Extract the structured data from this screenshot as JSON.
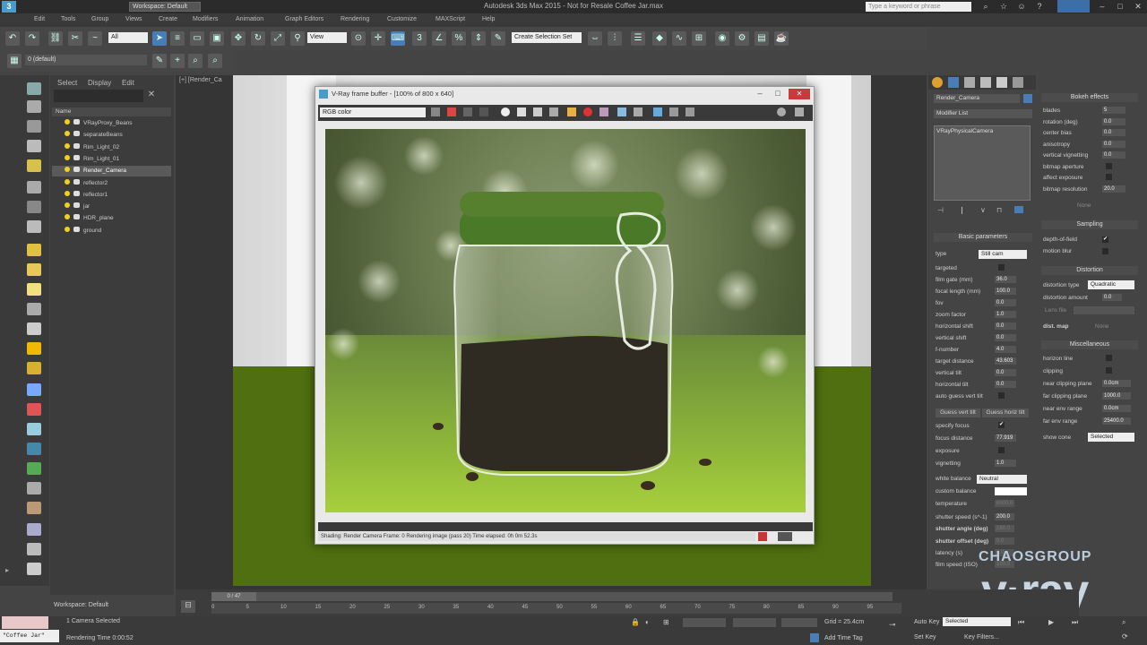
{
  "app": {
    "window_title": "Autodesk 3ds Max 2015 - Not for Resale   Coffee Jar.max",
    "workspace": "Workspace: Default",
    "search_placeholder": "Type a keyword or phrase"
  },
  "menus": [
    "Edit",
    "Tools",
    "Group",
    "Views",
    "Create",
    "Modifiers",
    "Animation",
    "Graph Editors",
    "Rendering",
    "Customize",
    "MAXScript",
    "Help"
  ],
  "toolbar": {
    "selection_filter": "All",
    "coord_system": "View",
    "named_selection": "Create Selection Set",
    "layer_dropdown": "0 (default)"
  },
  "scene_explorer": {
    "tabs": [
      "Select",
      "Display",
      "Edit"
    ],
    "column_header": "Name",
    "items": [
      {
        "label": "VRayProxy_Beans",
        "selected": false
      },
      {
        "label": "separateBeans",
        "selected": false
      },
      {
        "label": "Rim_Light_02",
        "selected": false
      },
      {
        "label": "Rim_Light_01",
        "selected": false
      },
      {
        "label": "Render_Camera",
        "selected": true
      },
      {
        "label": "reflector2",
        "selected": false
      },
      {
        "label": "reflector1",
        "selected": false
      },
      {
        "label": "jar",
        "selected": false
      },
      {
        "label": "HDR_plane",
        "selected": false
      },
      {
        "label": "ground",
        "selected": false
      }
    ],
    "workspace_footer": "Workspace: Default"
  },
  "viewport": {
    "label": "[+] [Render_Ca"
  },
  "vfb": {
    "title": "V-Ray frame buffer - [100% of 800 x 640]",
    "channel": "RGB color",
    "status_text": "Shading: Render Camera   Frame: 0   Rendering image (pass 20)   Time elapsed: 0h 0m 52.3s"
  },
  "command_panel": {
    "object_name": "Render_Camera",
    "modifier_list": "Modifier List",
    "stack_item": "VRayPhysicalCamera",
    "basic_params": {
      "header": "Basic parameters",
      "type_label": "type",
      "type_value": "Still cam",
      "rows": [
        {
          "label": "targeted",
          "value": ""
        },
        {
          "label": "film gate (mm)",
          "value": "36.0"
        },
        {
          "label": "focal length (mm)",
          "value": "100.0"
        },
        {
          "label": "fov",
          "value": "0.0"
        },
        {
          "label": "zoom factor",
          "value": "1.0"
        },
        {
          "label": "horizontal shift",
          "value": "0.0"
        },
        {
          "label": "vertical shift",
          "value": "0.0"
        },
        {
          "label": "f-number",
          "value": "4.0"
        },
        {
          "label": "target distance",
          "value": "43.603"
        },
        {
          "label": "vertical tilt",
          "value": "0.0"
        },
        {
          "label": "horizontal tilt",
          "value": "0.0"
        },
        {
          "label": "auto guess vert tilt",
          "value": ""
        }
      ],
      "guess_vert": "Guess vert tilt",
      "guess_horiz": "Guess horiz tilt",
      "rows2": [
        {
          "label": "specify focus",
          "value": "✔"
        },
        {
          "label": "focus distance",
          "value": "77.919"
        },
        {
          "label": "exposure",
          "value": ""
        },
        {
          "label": "vignetting",
          "value": "1.0"
        }
      ],
      "white_balance_label": "white balance",
      "white_balance_value": "Neutral",
      "custom_balance": "custom balance",
      "temperature": "temperature",
      "temperature_value": "6500.0",
      "shutter_speed": "shutter speed (s^-1)",
      "shutter_speed_value": "200.0",
      "shutter_angle": "shutter angle (deg)",
      "shutter_angle_value": "180.0",
      "shutter_offset": "shutter offset (deg)",
      "shutter_offset_value": "0.0",
      "latency": "latency (s)",
      "latency_value": "0.0",
      "film_speed": "film speed (ISO)",
      "film_speed_value": "100.0"
    },
    "bokeh": {
      "header": "Bokeh effects",
      "rows": [
        {
          "label": "blades",
          "value": "5"
        },
        {
          "label": "rotation (deg)",
          "value": "0.0"
        },
        {
          "label": "center bias",
          "value": "0.0"
        },
        {
          "label": "anisotropy",
          "value": "0.0"
        },
        {
          "label": "vertical vignetting",
          "value": "0.0"
        },
        {
          "label": "bitmap aperture",
          "value": ""
        },
        {
          "label": "affect exposure",
          "value": ""
        },
        {
          "label": "bitmap resolution",
          "value": "20.0"
        }
      ],
      "none_btn": "None"
    },
    "sampling": {
      "header": "Sampling",
      "dof": "depth-of-field",
      "motion_blur": "motion blur"
    },
    "distortion": {
      "header": "Distortion",
      "type_label": "distortion type",
      "type_value": "Quadratic",
      "amount_label": "distortion amount",
      "amount_value": "0.0",
      "lens_file": "Lens file",
      "dist_map": "dist. map",
      "none_btn": "None"
    },
    "misc": {
      "header": "Miscellaneous",
      "rows": [
        {
          "label": "horizon line",
          "value": ""
        },
        {
          "label": "clipping",
          "value": ""
        },
        {
          "label": "near clipping plane",
          "value": "0.0cm"
        },
        {
          "label": "far clipping plane",
          "value": "1000.0"
        },
        {
          "label": "near env range",
          "value": "0.0cm"
        },
        {
          "label": "far env range",
          "value": "25400.0"
        }
      ],
      "show_cone": "show cone",
      "show_cone_value": "Selected"
    }
  },
  "timeline": {
    "frame_display": "0 / 47",
    "ticks": [
      "0",
      "5",
      "10",
      "15",
      "20",
      "25",
      "30",
      "35",
      "40",
      "45",
      "50",
      "55",
      "60",
      "65",
      "70",
      "75",
      "80",
      "85",
      "90",
      "95"
    ]
  },
  "status": {
    "maxscript": "\"Coffee Jar\"",
    "selected": "1 Camera Selected",
    "rendering_time": "Rendering Time 0:00:52",
    "grid": "Grid = 25.4cm",
    "add_time_tag": "Add Time Tag",
    "auto_key": "Auto Key",
    "auto_key_value": "Selected",
    "set_key": "Set Key",
    "key_filters": "Key Filters..."
  },
  "branding": {
    "chaos": "CHAOSGROUP",
    "vray": "v·ray"
  }
}
